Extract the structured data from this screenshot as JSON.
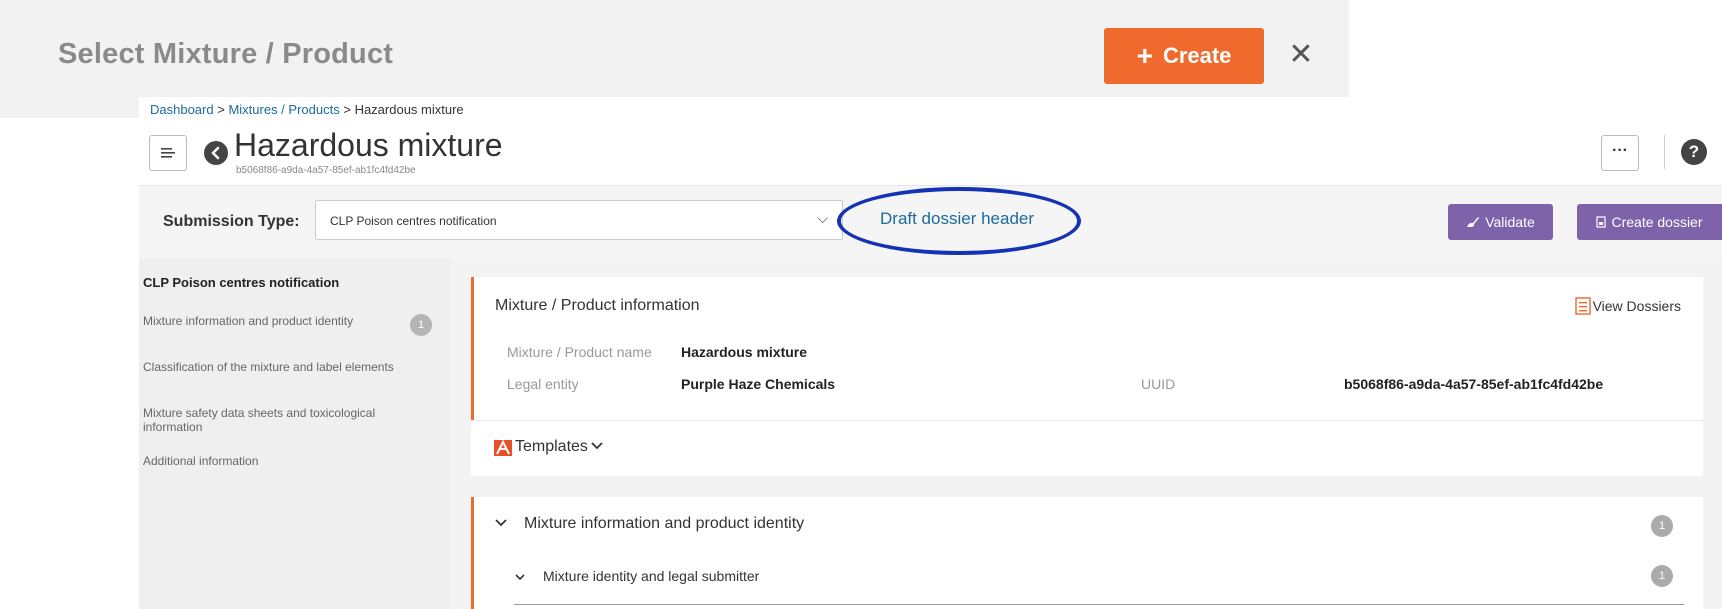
{
  "background_panel": {
    "title": "Select Mixture / Product",
    "create_label": "Create",
    "create_plus": "+",
    "close_glyph": "✕",
    "accent_color": "#f06a2e"
  },
  "breadcrumb": {
    "items": [
      "Dashboard",
      "Mixtures / Products"
    ],
    "separator": ">",
    "current": "Hazardous mixture"
  },
  "header": {
    "title": "Hazardous mixture",
    "uuid": "b5068f86-a9da-4a57-85ef-ab1fc4fd42be",
    "more_glyph": "···",
    "help_glyph": "?"
  },
  "submission": {
    "label": "Submission Type:",
    "selected": "CLP Poison centres notification",
    "draft_link": "Draft dossier header",
    "validate_label": "Validate",
    "create_dossier_label": "Create dossier",
    "button_color": "#7e63ab",
    "highlight_color": "#1432b4"
  },
  "leftnav": {
    "title": "CLP Poison centres notification",
    "items": [
      {
        "label": "Mixture information and product identity",
        "badge": "1"
      },
      {
        "label": "Classification of the mixture and label elements"
      },
      {
        "label": "Mixture safety data sheets and toxicological information"
      },
      {
        "label": "Additional information"
      }
    ]
  },
  "info_card": {
    "title": "Mixture / Product information",
    "view_dossiers": "View Dossiers",
    "fields": {
      "name_label": "Mixture / Product name",
      "name_value": "Hazardous mixture",
      "legal_label": "Legal entity",
      "legal_value": "Purple Haze Chemicals",
      "uuid_label": "UUID",
      "uuid_value": "b5068f86-a9da-4a57-85ef-ab1fc4fd42be"
    }
  },
  "templates": {
    "label": "Templates"
  },
  "section": {
    "title": "Mixture information and product identity",
    "badge": "1",
    "subsection": "Mixture identity and legal submitter",
    "sub_badge": "1"
  }
}
